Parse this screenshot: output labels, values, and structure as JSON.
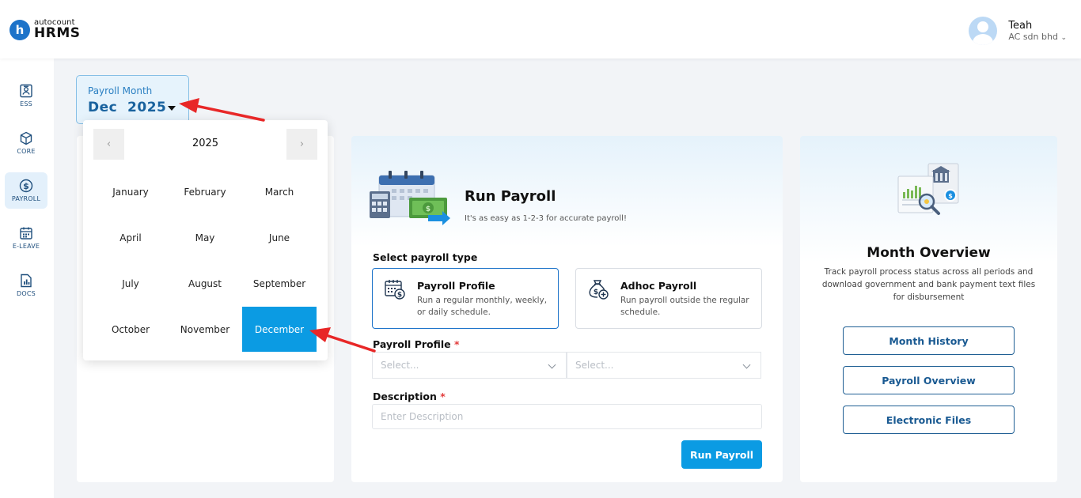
{
  "header": {
    "logo_small": "autocount",
    "logo_big": "HRMS",
    "user_name": "Teah",
    "user_company": "AC sdn bhd"
  },
  "sidebar": {
    "items": [
      {
        "label": "ESS",
        "icon": "id-card-icon"
      },
      {
        "label": "CORE",
        "icon": "cube-icon"
      },
      {
        "label": "PAYROLL",
        "icon": "dollar-circle-icon",
        "active": true
      },
      {
        "label": "E-LEAVE",
        "icon": "calendar-icon"
      },
      {
        "label": "DOCS",
        "icon": "document-chart-icon"
      }
    ]
  },
  "payroll_month": {
    "label": "Payroll Month",
    "value": "Dec  2025"
  },
  "month_picker": {
    "prev": "‹",
    "next": "›",
    "year": "2025",
    "months": [
      "January",
      "February",
      "March",
      "April",
      "May",
      "June",
      "July",
      "August",
      "September",
      "October",
      "November",
      "December"
    ],
    "selected": "December"
  },
  "run_payroll": {
    "title": "Run Payroll",
    "subtitle": "It's as easy as 1-2-3 for accurate payroll!",
    "type_label": "Select payroll type",
    "types": [
      {
        "title": "Payroll Profile",
        "desc": "Run a regular monthly, weekly, or daily schedule."
      },
      {
        "title": "Adhoc Payroll",
        "desc": "Run payroll outside the regular schedule."
      }
    ],
    "profile_label": "Payroll Profile",
    "profile_select_1": "Select...",
    "profile_select_2": "Select...",
    "description_label": "Description",
    "description_placeholder": "Enter Description",
    "required_mark": "*",
    "button": "Run Payroll"
  },
  "month_overview": {
    "title": "Month Overview",
    "description": "Track payroll process status across all periods and download government and bank payment text files for disbursement",
    "buttons": [
      "Month History",
      "Payroll Overview",
      "Electronic Files"
    ]
  },
  "colors": {
    "accent": "#0b9be3",
    "brand": "#1d73c9",
    "annotation": "#e82727"
  }
}
